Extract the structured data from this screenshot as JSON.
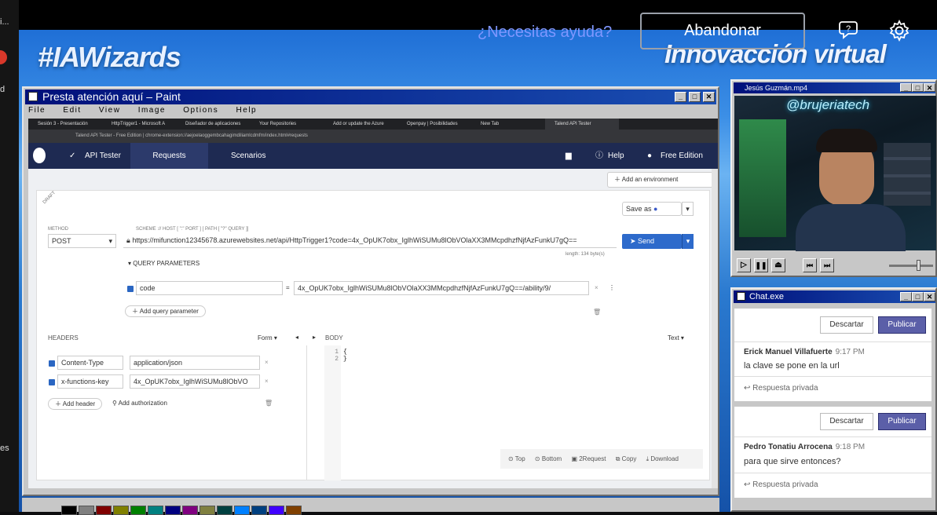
{
  "left_strip": {
    "items": [
      "i...",
      "d",
      "es"
    ]
  },
  "header": {
    "help_link": "¿Necesitas ayuda?",
    "abandon": "Abandonar"
  },
  "banner": {
    "hashtag": "#IAWizards",
    "tagline": "Innovacción virtual"
  },
  "paint": {
    "title": "Presta atención aquí – Paint",
    "menu": [
      "File",
      "Edit",
      "View",
      "Image",
      "Options",
      "Help"
    ],
    "chrome_tabs": [
      "Sesión 3 - Presentación",
      "HttpTrigger1 - Microsoft A",
      "Diseñador de aplicaciones",
      "Your Repositories",
      "Add or update the Azure",
      "Openpay | Posibilidades",
      "New Tab",
      "Talend API Tester"
    ],
    "chrome_url": "Talend API Tester - Free Edition | chrome-extension://aejoelaoggembcahagimdiliamlcdmfm/index.html#requests",
    "app": {
      "nav": {
        "brand": "API Tester",
        "requests": "Requests",
        "scenarios": "Scenarios",
        "help": "Help",
        "edition": "Free Edition"
      },
      "add_env": "Add an environment",
      "draft": "DRAFT",
      "save_as": "Save as",
      "method_label": "METHOD",
      "method": "POST",
      "scheme_label": "SCHEME :// HOST [ \":\" PORT ] [ PATH [ \"?\" QUERY ]]",
      "url": "https://mifunction12345678.azurewebsites.net/api/HttpTrigger1?code=4x_OpUK7obx_IglhWiSUMu8lObVOlaXX3MMcpdhzfNjfAzFunkU7gQ==",
      "length": "length: 134 byte(s)",
      "send": "Send",
      "query_params": "QUERY PARAMETERS",
      "query": {
        "name": "code",
        "value": "4x_OpUK7obx_IglhWiSUMu8lObVOlaXX3MMcpdhzfNjfAzFunkU7gQ==/ability/9/"
      },
      "add_query": "Add query parameter",
      "headers_label": "HEADERS",
      "form": "Form",
      "body_label": "BODY",
      "text": "Text",
      "headers": [
        {
          "name": "Content-Type",
          "value": "application/json"
        },
        {
          "name": "x-functions-key",
          "value": "4x_OpUK7obx_IglhWiSUMu8lObVO"
        }
      ],
      "add_header": "Add header",
      "add_auth": "Add authorization",
      "body_lines": [
        "1",
        "2"
      ],
      "body_code": [
        "{",
        "}"
      ],
      "footer": {
        "top": "Top",
        "bottom": "Bottom",
        "to_request": "2Request",
        "copy": "Copy",
        "download": "Download"
      }
    }
  },
  "video": {
    "title": "Jesús Guzmán.mp4",
    "overlay": "@brujeriatech"
  },
  "chat": {
    "title": "Chat.exe",
    "discard": "Descartar",
    "publish": "Publicar",
    "reply": "Respuesta privada",
    "messages": [
      {
        "author": "Erick Manuel Villafuerte",
        "time": "9:17 PM",
        "text": "la clave se pone en la url"
      },
      {
        "author": "Pedro Tonatiu Arrocena",
        "time": "9:18 PM",
        "text": "para que sirve entonces?"
      }
    ]
  },
  "palette_colors": [
    "#000000",
    "#808080",
    "#800000",
    "#808000",
    "#008000",
    "#008080",
    "#000080",
    "#800080",
    "#808040",
    "#004040",
    "#0080ff",
    "#004080",
    "#4000ff",
    "#804000"
  ]
}
